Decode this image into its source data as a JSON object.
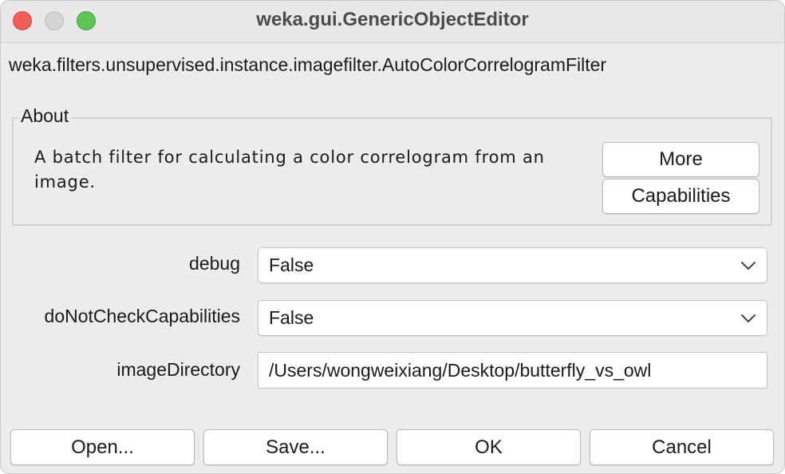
{
  "window": {
    "title": "weka.gui.GenericObjectEditor"
  },
  "editor": {
    "class_name": "weka.filters.unsupervised.instance.imagefilter.AutoColorCorrelogramFilter"
  },
  "about": {
    "legend": "About",
    "description": "A batch filter for calculating a color correlogram from an image.",
    "more_label": "More",
    "capabilities_label": "Capabilities"
  },
  "properties": [
    {
      "label": "debug",
      "value": "False",
      "type": "select"
    },
    {
      "label": "doNotCheckCapabilities",
      "value": "False",
      "type": "select"
    },
    {
      "label": "imageDirectory",
      "value": "/Users/wongweixiang/Desktop/butterfly_vs_owl",
      "type": "text"
    }
  ],
  "buttons": {
    "open": "Open...",
    "save": "Save...",
    "ok": "OK",
    "cancel": "Cancel"
  },
  "icons": {
    "close": "close-traffic-light-icon",
    "minimize": "minimize-traffic-light-icon",
    "zoom": "zoom-traffic-light-icon",
    "dropdown": "chevron-down-icon"
  },
  "colors": {
    "close": "#ee5f57",
    "zoom": "#5fc454",
    "window_bg": "#ececec"
  }
}
